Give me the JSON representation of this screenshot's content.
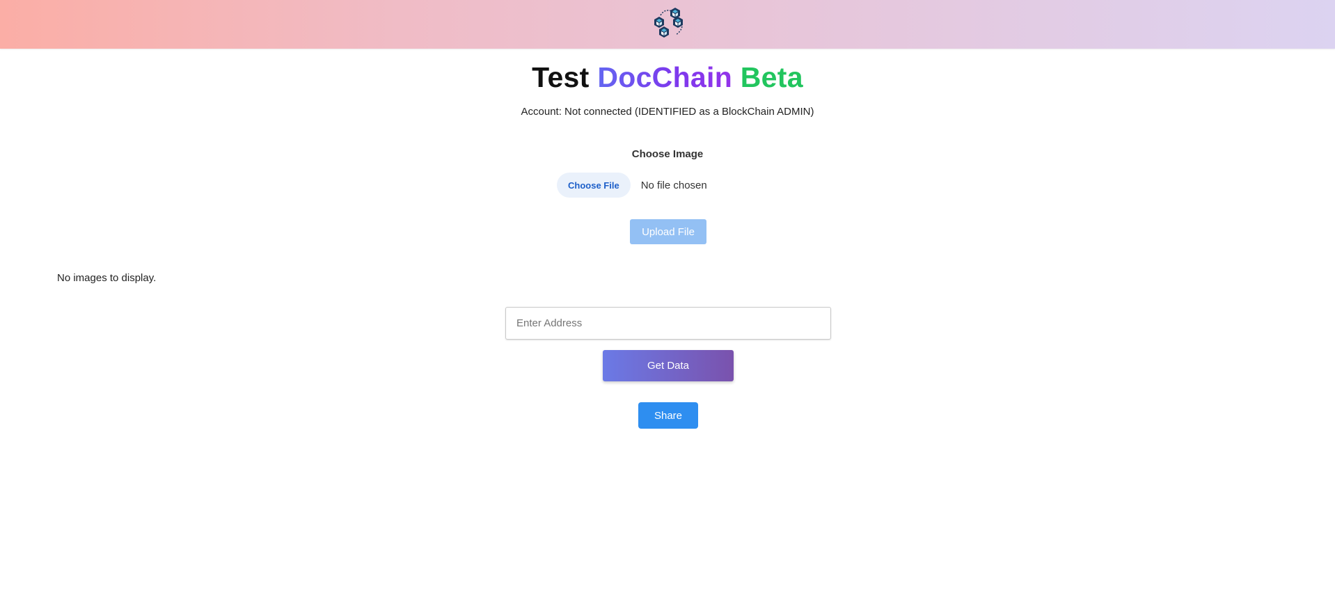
{
  "header": {
    "logo_icon": "blockchain-cubes-icon",
    "gradient_start": "#fbaea6",
    "gradient_end": "#dcd3f1"
  },
  "title": {
    "word1": "Test",
    "word2": "DocChain",
    "word3": "Beta",
    "word1_color": "#111111",
    "word2_color": "#7c3aed",
    "word3_color": "#22c55e"
  },
  "account": {
    "text": "Account: Not connected (IDENTIFIED as a BlockChain ADMIN)"
  },
  "upload": {
    "choose_label": "Choose Image",
    "file_button_label": "Choose File",
    "file_status": "No file chosen",
    "upload_button_label": "Upload File",
    "upload_button_color": "#93c0f4"
  },
  "gallery": {
    "empty_text": "No images to display."
  },
  "lookup": {
    "address_placeholder": "Enter Address",
    "address_value": "",
    "get_data_label": "Get Data"
  },
  "share": {
    "label": "Share",
    "color": "#2e8ef0"
  }
}
